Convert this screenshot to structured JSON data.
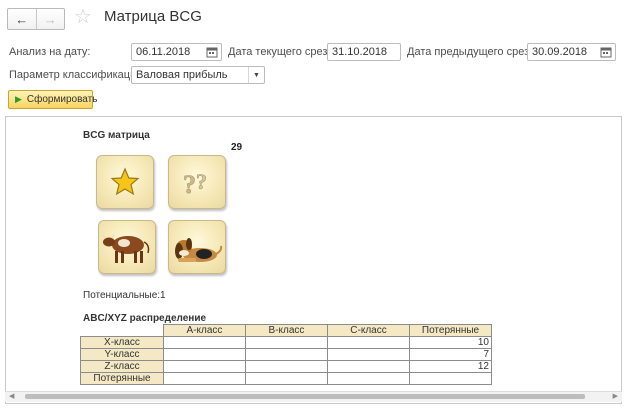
{
  "header": {
    "title": "Матрица BCG"
  },
  "form": {
    "analysis_date_label": "Анализ на дату:",
    "analysis_date_value": "06.11.2018",
    "current_cut_label": "Дата текущего среза:",
    "current_cut_value": "31.10.2018",
    "previous_cut_label": "Дата предыдущего среза:",
    "previous_cut_value": "30.09.2018",
    "param_label": "Параметр классификации:",
    "param_value": "Валовая прибыль"
  },
  "toolbar": {
    "generate_label": "Сформировать"
  },
  "report": {
    "bcg_title": "BCG матрица",
    "bcg_count": "29",
    "potential_text": "Потенциальные:1",
    "abc_title": "ABC/XYZ распределение",
    "columns": [
      "A-класс",
      "B-класс",
      "C-класс",
      "Потерянные"
    ],
    "rows": [
      {
        "label": "X-класс",
        "a": "",
        "b": "",
        "c": "",
        "lost": "10"
      },
      {
        "label": "Y-класс",
        "a": "",
        "b": "",
        "c": "",
        "lost": "7"
      },
      {
        "label": "Z-класс",
        "a": "",
        "b": "",
        "c": "",
        "lost": "12"
      },
      {
        "label": "Потерянные",
        "a": "",
        "b": "",
        "c": "",
        "lost": ""
      }
    ]
  },
  "icons": {
    "tiles": [
      "star-icon",
      "question-icon",
      "cow-icon",
      "dog-icon"
    ]
  },
  "colors": {
    "accent_button": "#f8d45f",
    "tile_bg": "#f5e7b4",
    "table_header_bg": "#f4e9c4",
    "play_green": "#2e9a2e"
  }
}
